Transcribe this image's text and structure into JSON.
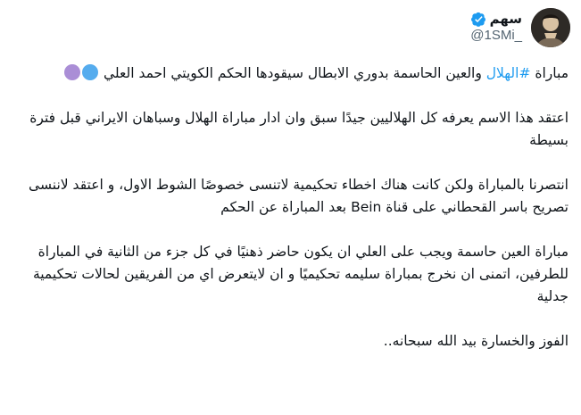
{
  "author": {
    "display_name": "سهم",
    "handle": "@1SMi_",
    "verified_icon": "verified-badge-icon",
    "avatar_icon": "profile-photo"
  },
  "tweet": {
    "p1_prefix": "مباراة ",
    "p1_hashtag": "#الهلال",
    "p1_suffix": " والعين الحاسمة بدوري الابطال سيقودها الحكم الكويتي احمد العلي",
    "p1_emojis": [
      "blue-circle-emoji",
      "purple-circle-emoji"
    ],
    "p2": "اعتقد هذا الاسم يعرفه كل الهلاليين جيدًا سبق وان ادار مباراة الهلال وسباهان الايراني قبل فترة بسيطة",
    "p3": "انتصرنا بالمباراة ولكن كانت هناك اخطاء تحكيمية لاتنسى خصوصًا الشوط الاول، و اعتقد لاننسى تصريح باسر القحطاني على قناة Bein بعد المباراة عن الحكم",
    "p4": "مباراة العين حاسمة ويجب على العلي ان يكون حاضر ذهنيًا في كل جزء من الثانية في المباراة للطرفين، اتمنى ان نخرج بمباراة سليمه تحكيميًا و ان لايتعرض اي من الفريقين لحالات تحكيمية جدلية",
    "p5": "الفوز والخسارة بيد الله سبحانه.."
  },
  "colors": {
    "accent": "#1d9bf0",
    "text": "#0f1419",
    "muted": "#536471",
    "blue_circle": "#55acee",
    "purple_circle": "#aa8ed6"
  }
}
